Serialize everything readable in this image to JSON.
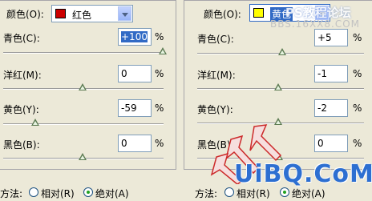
{
  "left": {
    "color_label": "颜色(O):",
    "color_value": "红色",
    "color_swatch": "#cc0000",
    "sliders": [
      {
        "label": "青色(C):",
        "value": "+100",
        "unit": "%",
        "selected": true,
        "level": 1.0
      },
      {
        "label": "洋红(M):",
        "value": "0",
        "unit": "%",
        "selected": false,
        "level": 0.5
      },
      {
        "label": "黄色(Y):",
        "value": "-59",
        "unit": "%",
        "selected": false,
        "level": 0.205
      },
      {
        "label": "黑色(B):",
        "value": "0",
        "unit": "%",
        "selected": false,
        "level": 0.5
      }
    ],
    "method_label": "方法:",
    "method_relative": "相对(R)",
    "method_absolute": "绝对(A)"
  },
  "right": {
    "color_label": "颜色(O):",
    "color_value": "黄色",
    "color_swatch": "#ffff00",
    "sliders": [
      {
        "label": "青色(C):",
        "value": "+5",
        "unit": "%",
        "level": 0.525
      },
      {
        "label": "洋红(M):",
        "value": "-1",
        "unit": "%",
        "level": 0.495
      },
      {
        "label": "黄色(Y):",
        "value": "-2",
        "unit": "%",
        "level": 0.49
      },
      {
        "label": "黑色(B):",
        "value": "0",
        "unit": "%",
        "level": 0.5
      }
    ],
    "method_label": "方法:",
    "method_relative": "相对(R)",
    "method_absolute": "绝对(A)"
  },
  "watermarks": {
    "top": "PS教程论坛",
    "url": "BBS.16XX8.COM",
    "bottom": "UiBQ.CoM"
  },
  "colors": {
    "watermark_red": "#cc2a2a",
    "watermark_blue": "#2d6fd1",
    "selection": "#316ac5"
  }
}
